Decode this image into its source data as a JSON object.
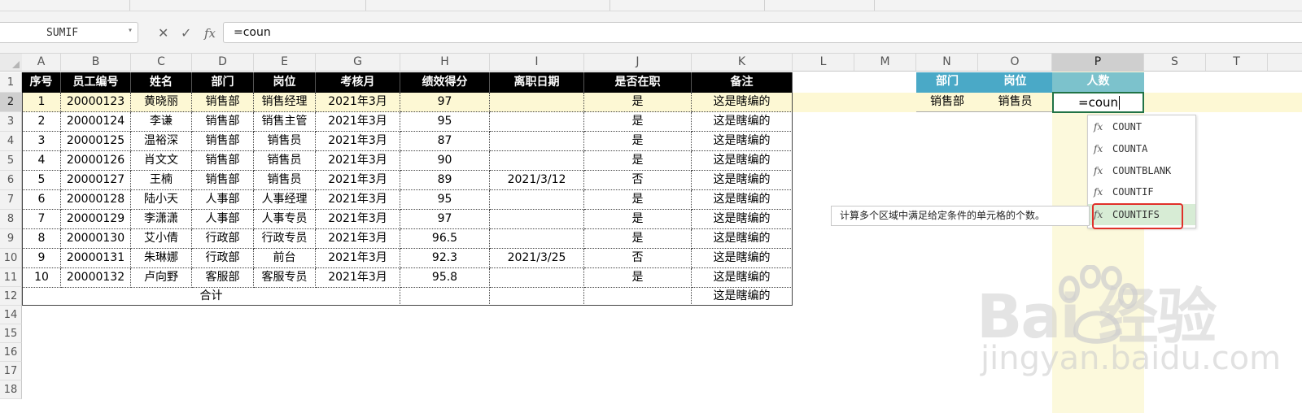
{
  "name_box": "SUMIF",
  "formula_bar": {
    "cancel": "✕",
    "enter": "✓",
    "fx": "fx",
    "value": "=coun"
  },
  "columns": [
    "A",
    "B",
    "C",
    "D",
    "E",
    "G",
    "H",
    "I",
    "J",
    "K",
    "L",
    "M",
    "N",
    "O",
    "P",
    "S",
    "T"
  ],
  "rows": [
    "1",
    "2",
    "3",
    "4",
    "5",
    "6",
    "7",
    "8",
    "9",
    "10",
    "11",
    "12",
    "14",
    "15",
    "16",
    "17",
    "18"
  ],
  "table_headers": [
    "序号",
    "员工编号",
    "姓名",
    "部门",
    "岗位",
    "考核月",
    "绩效得分",
    "离职日期",
    "是否在职",
    "备注"
  ],
  "table_rows": [
    [
      "1",
      "20000123",
      "黄晓丽",
      "销售部",
      "销售经理",
      "2021年3月",
      "97",
      "",
      "是",
      "这是瞎编的"
    ],
    [
      "2",
      "20000124",
      "李谦",
      "销售部",
      "销售主管",
      "2021年3月",
      "95",
      "",
      "是",
      "这是瞎编的"
    ],
    [
      "3",
      "20000125",
      "温裕深",
      "销售部",
      "销售员",
      "2021年3月",
      "87",
      "",
      "是",
      "这是瞎编的"
    ],
    [
      "4",
      "20000126",
      "肖文文",
      "销售部",
      "销售员",
      "2021年3月",
      "90",
      "",
      "是",
      "这是瞎编的"
    ],
    [
      "5",
      "20000127",
      "王楠",
      "销售部",
      "销售员",
      "2021年3月",
      "89",
      "2021/3/12",
      "否",
      "这是瞎编的"
    ],
    [
      "6",
      "20000128",
      "陆小天",
      "人事部",
      "人事经理",
      "2021年3月",
      "95",
      "",
      "是",
      "这是瞎编的"
    ],
    [
      "7",
      "20000129",
      "李潇潇",
      "人事部",
      "人事专员",
      "2021年3月",
      "97",
      "",
      "是",
      "这是瞎编的"
    ],
    [
      "8",
      "20000130",
      "艾小倩",
      "行政部",
      "行政专员",
      "2021年3月",
      "96.5",
      "",
      "是",
      "这是瞎编的"
    ],
    [
      "9",
      "20000131",
      "朱琳娜",
      "行政部",
      "前台",
      "2021年3月",
      "92.3",
      "2021/3/25",
      "否",
      "这是瞎编的"
    ],
    [
      "10",
      "20000132",
      "卢向野",
      "客服部",
      "客服专员",
      "2021年3月",
      "95.8",
      "",
      "是",
      "这是瞎编的"
    ]
  ],
  "total_row": {
    "label": "合计",
    "note": "这是瞎编的"
  },
  "side_table": {
    "headers": [
      "部门",
      "岗位",
      "人数"
    ],
    "values": [
      "销售部",
      "销售员",
      "=coun"
    ]
  },
  "autocomplete": {
    "items": [
      "COUNT",
      "COUNTA",
      "COUNTBLANK",
      "COUNTIF",
      "COUNTIFS"
    ],
    "selected": "COUNTIFS",
    "fx": "fx"
  },
  "tooltip": "计算多个区域中满足给定条件的单元格的个数。",
  "watermark": {
    "logo": "Bai  经验",
    "url": "jingyan.baidu.com"
  },
  "colors": {
    "header_black": "#000000",
    "side_header_blue": "#4aa9c7",
    "count_header_teal": "#7cc2cc",
    "row_highlight": "#fdf8d4",
    "column_highlight": "#fcf9dc",
    "highlight_border": "#e0302a",
    "active_cell_border": "#217346"
  }
}
